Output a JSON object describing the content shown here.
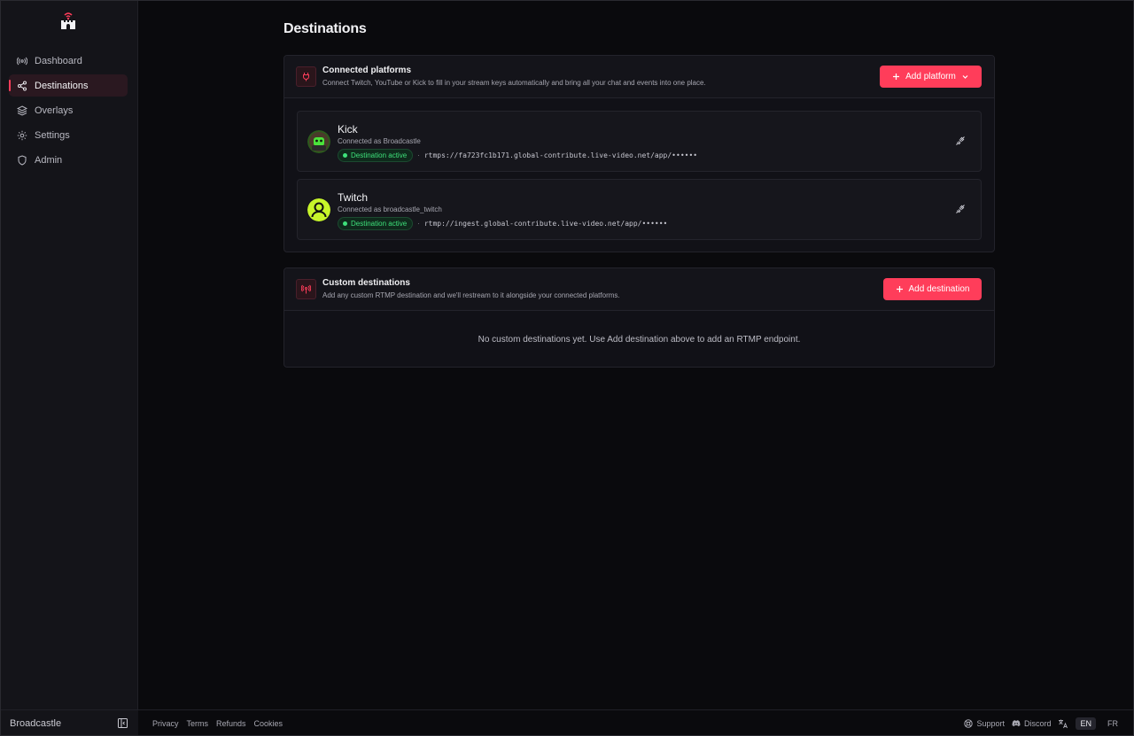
{
  "sidebar": {
    "items": [
      {
        "label": "Dashboard",
        "icon": "broadcast-icon"
      },
      {
        "label": "Destinations",
        "icon": "share-icon",
        "active": true
      },
      {
        "label": "Overlays",
        "icon": "layers-icon"
      },
      {
        "label": "Settings",
        "icon": "gear-icon"
      },
      {
        "label": "Admin",
        "icon": "shield-icon"
      }
    ],
    "brand": "Broadcastle"
  },
  "page": {
    "title": "Destinations"
  },
  "connected": {
    "title": "Connected platforms",
    "subtitle": "Connect Twitch, YouTube or Kick to fill in your stream keys automatically and bring all your chat and events into one place.",
    "add_label": "Add platform",
    "platforms": [
      {
        "name": "Kick",
        "connected_as": "Connected as Broadcastle",
        "status": "Destination active",
        "separator": "·",
        "url": "rtmps://fa723fc1b171.global-contribute.live-video.net/app/••••••"
      },
      {
        "name": "Twitch",
        "connected_as": "Connected as broadcastle_twitch",
        "status": "Destination active",
        "separator": "·",
        "url": "rtmp://ingest.global-contribute.live-video.net/app/••••••"
      }
    ]
  },
  "custom": {
    "title": "Custom destinations",
    "subtitle": "Add any custom RTMP destination and we'll restream to it alongside your connected platforms.",
    "add_label": "Add destination",
    "empty": "No custom destinations yet. Use Add destination above to add an RTMP endpoint."
  },
  "footer": {
    "links": [
      "Privacy",
      "Terms",
      "Refunds",
      "Cookies"
    ],
    "support": "Support",
    "discord": "Discord",
    "langs": [
      "EN",
      "FR"
    ],
    "active_lang": "EN"
  },
  "colors": {
    "accent": "#ff3d5a",
    "success": "#3ee07a",
    "background": "#0a0a0d"
  }
}
